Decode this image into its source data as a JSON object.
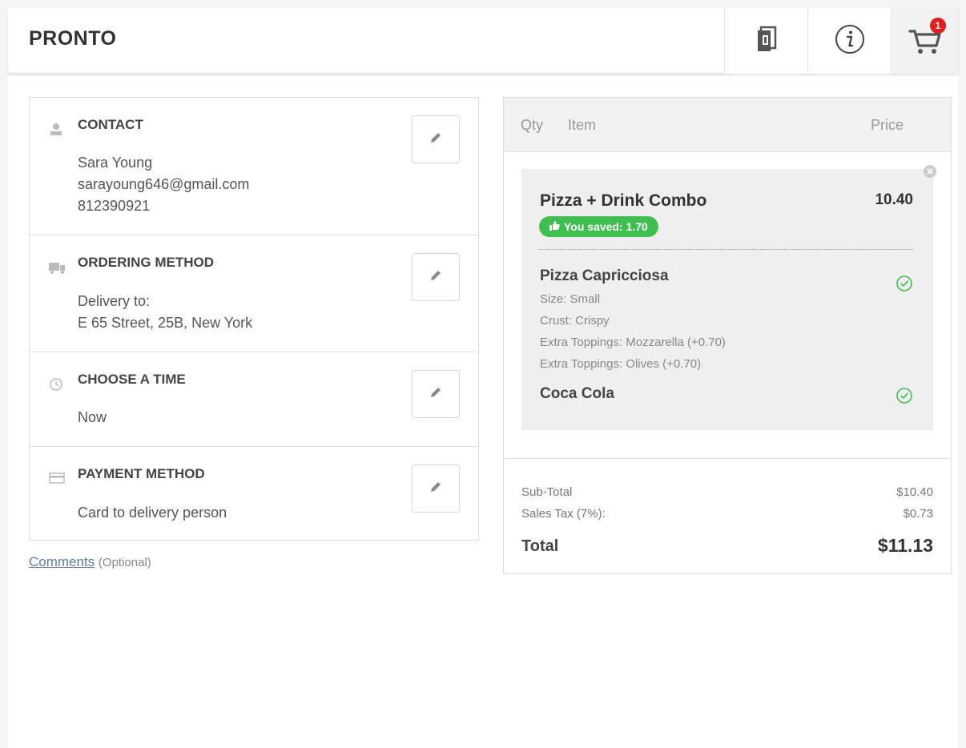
{
  "header": {
    "brand": "PRONTO",
    "cart_count": "1"
  },
  "sections": {
    "contact": {
      "title": "CONTACT",
      "name": "Sara Young",
      "email": "sarayoung646@gmail.com",
      "phone": "812390921"
    },
    "ordering": {
      "title": "ORDERING METHOD",
      "line1": "Delivery to:",
      "line2": "E 65 Street, 25B, New York"
    },
    "time": {
      "title": "CHOOSE A TIME",
      "value": "Now"
    },
    "payment": {
      "title": "PAYMENT METHOD",
      "value": "Card to delivery person"
    }
  },
  "comments": {
    "link": "Comments",
    "optional": "(Optional)"
  },
  "cart": {
    "columns": {
      "qty": "Qty",
      "item": "Item",
      "price": "Price"
    },
    "combo": {
      "name": "Pizza + Drink Combo",
      "price": "10.40",
      "saved": "You saved: 1.70",
      "items": [
        {
          "name": "Pizza Capricciosa",
          "options": [
            "Size: Small",
            "Crust: Crispy",
            "Extra Toppings: Mozzarella (+0.70)",
            "Extra Toppings: Olives (+0.70)"
          ]
        },
        {
          "name": "Coca Cola",
          "options": []
        }
      ]
    },
    "summary": {
      "subtotal_label": "Sub-Total",
      "subtotal": "$10.40",
      "tax_label": "Sales Tax (7%):",
      "tax": "$0.73",
      "total_label": "Total",
      "total": "$11.13"
    }
  },
  "colors": {
    "saved_badge": "#3fbf4f",
    "cart_badge": "#e02020",
    "check": "#3fbf4f",
    "link": "#5b7fa3"
  }
}
